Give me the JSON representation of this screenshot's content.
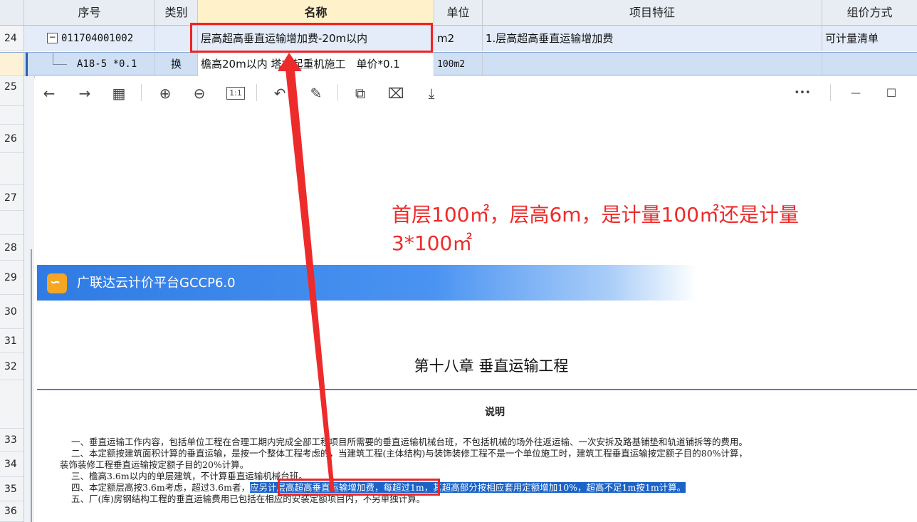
{
  "grid": {
    "headers": {
      "seq": "序号",
      "category": "类别",
      "name": "名称",
      "unit": "单位",
      "features": "项目特征",
      "pricing": "组价方式"
    },
    "row_main": {
      "num": "24",
      "toggle": "−",
      "code": "011704001002",
      "category": "",
      "name": "层高超高垂直运输增加费-20m以内",
      "unit": "m2",
      "features": "1.层高超高垂直运输增加费",
      "pricing": "可计量清单"
    },
    "row_sub": {
      "code": "A18-5 *0.1",
      "category": "换",
      "name": "檐高20m以内 塔式起重机施工　单价*0.1",
      "unit": "100m2"
    },
    "row_numbers": [
      "25",
      "26",
      "27",
      "28",
      "29",
      "30",
      "31",
      "32",
      "33",
      "34",
      "35",
      "36"
    ]
  },
  "toolbar": {
    "icons": [
      "back-arrow-icon",
      "forward-arrow-icon",
      "grid-view-icon",
      "zoom-in-icon",
      "zoom-out-icon",
      "actual-size-icon",
      "rotate-icon",
      "annotate-icon",
      "translate-icon",
      "clear-icon",
      "download-icon",
      "more-icon",
      "minimize-icon",
      "maximize-icon"
    ],
    "glyphs": {
      "back": "←",
      "forward": "→",
      "grid": "▦",
      "zoom_in": "⊕",
      "zoom_out": "⊖",
      "actual": "1:1",
      "rotate": "↶",
      "annotate": "✎",
      "translate": "⧉",
      "clear": "⌧",
      "download": "⤓",
      "more": "•••",
      "minimize": "—",
      "maximize": "☐"
    }
  },
  "banner": {
    "title": "广联达云计价平台GCCP6.0"
  },
  "doc": {
    "chapter_title": "第十八章  垂直运输工程",
    "section_title": "说明",
    "p1": "一、垂直运输工作内容，包括单位工程在合理工期内完成全部工程项目所需要的垂直运输机械台班，不包括机械的场外往返运输、一次安拆及路基铺垫和轨道铺拆等的费用。",
    "p2a": "二、本定额按建筑面积计算的垂直运输，是按一个整体工程考虑的，当建筑工程(主体结构)与装饰装修工程不是一个单位施工时，建筑工程垂直运输按定额子目的80%计算，",
    "p2b": "装饰装修工程垂直运输按定额子目的20%计算。",
    "p3": "三、檐高3.6m以内的单层建筑，不计算垂直运输机械台班。",
    "p4_prefix": "四、本定额层高按3.6m考虑，超过3.6m者，",
    "p4_highlight": "应另计层高超高垂直运输增加费，每超过1m，其超高部分按相应套用定额增加10%，超高不足1m按1m计算。",
    "p5": "五、厂(库)房钢结构工程的垂直运输费用已包括在相应的安装定额项目内，不另单独计算。"
  },
  "annotation": {
    "line1": "首层100㎡，层高6m，是计量100㎡还是计量",
    "line2": "3*100㎡"
  },
  "colors": {
    "annotation": "#ee2b2b",
    "selected_row": "#cfe0f5",
    "highlight": "#1b63c8",
    "banner": "#2f7be3"
  }
}
